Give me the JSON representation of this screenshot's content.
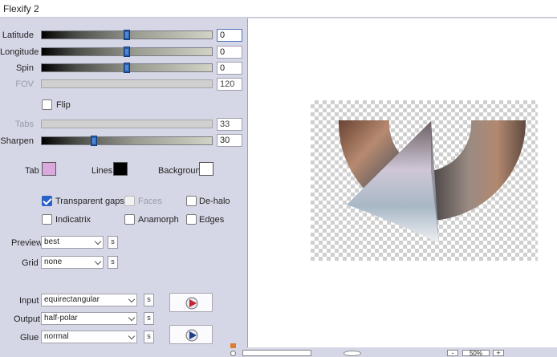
{
  "window": {
    "title": "Flexify 2"
  },
  "sliders": [
    {
      "label": "Latitude",
      "value": "0",
      "position": 0.5,
      "disabled": false
    },
    {
      "label": "Longitude",
      "value": "0",
      "position": 0.5,
      "disabled": false
    },
    {
      "label": "Spin",
      "value": "0",
      "position": 0.5,
      "disabled": false
    },
    {
      "label": "FOV",
      "value": "120",
      "disabled": true
    },
    {
      "label": "Tabs",
      "value": "33",
      "disabled": true
    },
    {
      "label": "Sharpen",
      "value": "30",
      "position": 0.3,
      "disabled": false
    }
  ],
  "flip": {
    "label": "Flip",
    "checked": false
  },
  "colors": {
    "tab": {
      "label": "Tab",
      "color": "#d9a8dc"
    },
    "lines": {
      "label": "Lines",
      "color": "#000000"
    },
    "background": {
      "label": "Background",
      "color": "#ffffff"
    }
  },
  "options": [
    {
      "label": "Transparent gaps",
      "checked": true,
      "disabled": false
    },
    {
      "label": "Faces",
      "checked": false,
      "disabled": true
    },
    {
      "label": "De-halo",
      "checked": false,
      "disabled": false
    },
    {
      "label": "Indicatrix",
      "checked": false,
      "disabled": false
    },
    {
      "label": "Anamorph",
      "checked": false,
      "disabled": false
    },
    {
      "label": "Edges",
      "checked": false,
      "disabled": false
    }
  ],
  "preview": {
    "label": "Preview",
    "value": "best"
  },
  "grid": {
    "label": "Grid",
    "value": "none"
  },
  "input": {
    "label": "Input",
    "value": "equirectangular"
  },
  "output": {
    "label": "Output",
    "value": "half-polar"
  },
  "glue": {
    "label": "Glue",
    "value": "normal"
  },
  "s_button_label": "s",
  "zoom": {
    "value": "50%",
    "minus": "-",
    "plus": "+"
  }
}
